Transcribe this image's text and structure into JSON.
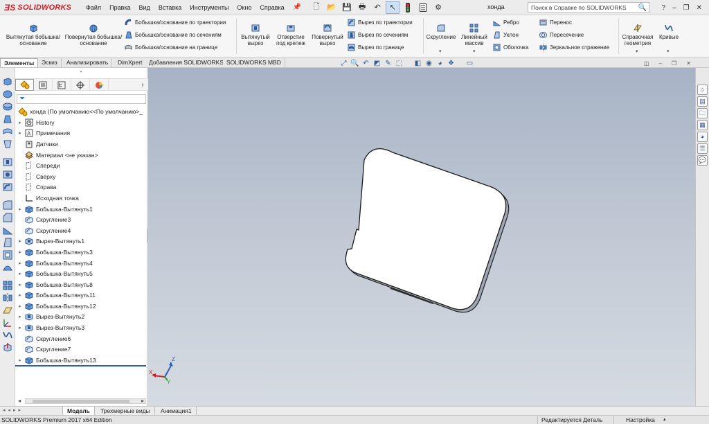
{
  "app": {
    "brand": "SOLIDWORKS",
    "doc_title": "хонда"
  },
  "menu": [
    "Файл",
    "Правка",
    "Вид",
    "Вставка",
    "Инструменты",
    "Окно",
    "Справка"
  ],
  "help_search": {
    "placeholder": "Поиск в Справке по SOLIDWORKS"
  },
  "ribbon": {
    "extruded_boss": "Вытянутая бобышка/основание",
    "revolved_boss": "Повернутая бобышка/основание",
    "swept_boss": "Бобышка/основание по траектории",
    "lofted_boss": "Бобышка/основание по сечениям",
    "boundary_boss": "Бобышка/основание на границе",
    "extruded_cut": "Вытянутый вырез",
    "hole_wizard": "Отверстие под крепеж",
    "revolved_cut": "Повернутый вырез",
    "swept_cut": "Вырез по траектории",
    "lofted_cut": "Вырез по сечениям",
    "boundary_cut": "Вырез по границе",
    "fillet": "Скругление",
    "linear_pattern": "Линейный массив",
    "rib": "Ребро",
    "draft": "Уклон",
    "shell": "Оболочка",
    "wrap": "Перенос",
    "intersect": "Пересечение",
    "mirror": "Зеркальное отражение",
    "ref_geometry": "Справочная геометрия",
    "curves": "Кривые"
  },
  "cm_tabs": [
    "Элементы",
    "Эскиз",
    "Анализировать",
    "DimXpert",
    "Добавления SOLIDWORKS",
    "SOLIDWORKS MBD"
  ],
  "feature_tree": {
    "root": "хонда  (По умолчанию<<По умолчанию>_",
    "items": [
      {
        "label": "History",
        "expandable": true,
        "icon": "history-icon"
      },
      {
        "label": "Примечания",
        "expandable": true,
        "icon": "annotations-icon"
      },
      {
        "label": "Датчики",
        "expandable": false,
        "icon": "sensors-icon"
      },
      {
        "label": "Материал <не указан>",
        "expandable": false,
        "icon": "material-icon"
      },
      {
        "label": "Спереди",
        "expandable": false,
        "icon": "plane-icon"
      },
      {
        "label": "Сверху",
        "expandable": false,
        "icon": "plane-icon"
      },
      {
        "label": "Справа",
        "expandable": false,
        "icon": "plane-icon"
      },
      {
        "label": "Исходная точка",
        "expandable": false,
        "icon": "origin-icon"
      },
      {
        "label": "Бобышка-Вытянуть1",
        "expandable": true,
        "icon": "extrude-icon"
      },
      {
        "label": "Скругление3",
        "expandable": false,
        "icon": "fillet-icon"
      },
      {
        "label": "Скругление4",
        "expandable": false,
        "icon": "fillet-icon"
      },
      {
        "label": "Вырез-Вытянуть1",
        "expandable": true,
        "icon": "cut-extrude-icon"
      },
      {
        "label": "Бобышка-Вытянуть3",
        "expandable": true,
        "icon": "extrude-icon"
      },
      {
        "label": "Бобышка-Вытянуть4",
        "expandable": true,
        "icon": "extrude-icon"
      },
      {
        "label": "Бобышка-Вытянуть5",
        "expandable": true,
        "icon": "extrude-icon"
      },
      {
        "label": "Бобышка-Вытянуть8",
        "expandable": true,
        "icon": "extrude-icon"
      },
      {
        "label": "Бобышка-Вытянуть11",
        "expandable": true,
        "icon": "extrude-icon"
      },
      {
        "label": "Бобышка-Вытянуть12",
        "expandable": true,
        "icon": "extrude-icon"
      },
      {
        "label": "Вырез-Вытянуть2",
        "expandable": true,
        "icon": "cut-extrude-icon"
      },
      {
        "label": "Вырез-Вытянуть3",
        "expandable": true,
        "icon": "cut-extrude-icon"
      },
      {
        "label": "Скругление6",
        "expandable": false,
        "icon": "fillet-icon"
      },
      {
        "label": "Скругление7",
        "expandable": false,
        "icon": "fillet-icon"
      },
      {
        "label": "Бобышка-Вытянуть13",
        "expandable": true,
        "icon": "extrude-icon"
      }
    ]
  },
  "bottom_tabs": [
    "Модель",
    "Трехмерные виды",
    "Анимация1"
  ],
  "status": {
    "edition": "SOLIDWORKS Premium 2017 x64 Edition",
    "state": "Редактируется Деталь",
    "custom": "Настройка"
  },
  "triad": {
    "x": "X",
    "y": "Y",
    "z": "Z"
  },
  "colors": {
    "brand": "#d21f26",
    "accent": "#2b5fb4",
    "icon_blue": "#3b6fb6"
  }
}
